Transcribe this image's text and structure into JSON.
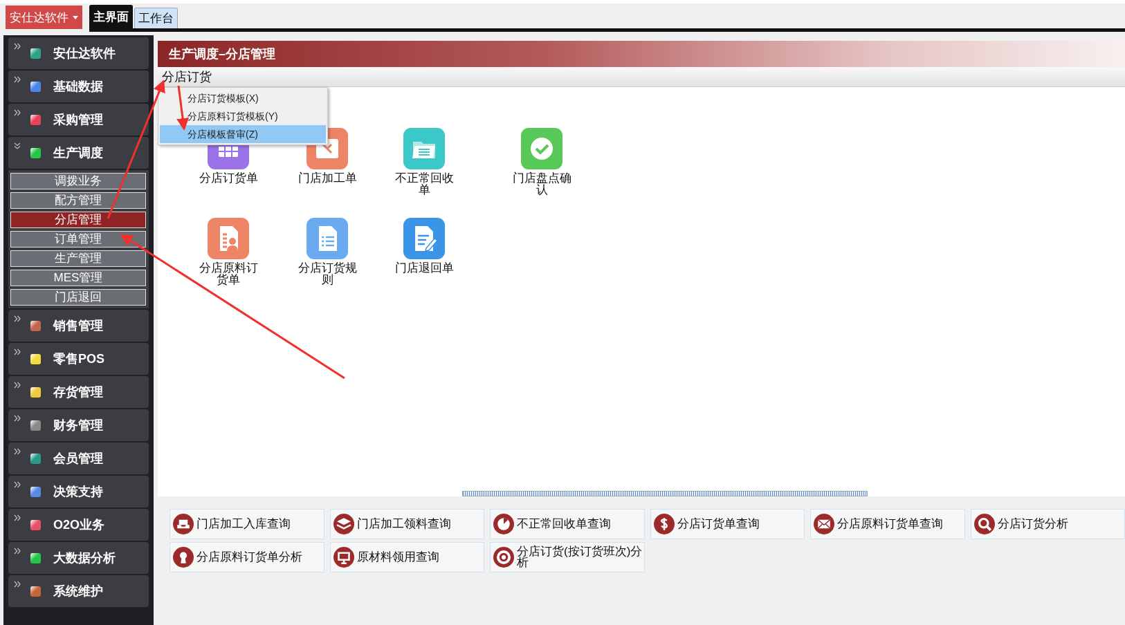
{
  "brand_menu": {
    "label": "安仕达软件"
  },
  "tabs": [
    {
      "label": "主界面",
      "selected": true
    },
    {
      "label": "工作台",
      "selected": false
    }
  ],
  "sidebar": {
    "items": [
      {
        "label": "安仕达软件",
        "color": "#2aa58a",
        "expanded": false
      },
      {
        "label": "基础数据",
        "color": "#4a86e8",
        "expanded": false
      },
      {
        "label": "采购管理",
        "color": "#e8415a",
        "expanded": false
      },
      {
        "label": "生产调度",
        "color": "#22c84a",
        "expanded": true,
        "children": [
          {
            "label": "调拨业务",
            "selected": false
          },
          {
            "label": "配方管理",
            "selected": false
          },
          {
            "label": "分店管理",
            "selected": true
          },
          {
            "label": "订单管理",
            "selected": false
          },
          {
            "label": "生产管理",
            "selected": false
          },
          {
            "label": "MES管理",
            "selected": false
          },
          {
            "label": "门店退回",
            "selected": false
          }
        ]
      },
      {
        "label": "销售管理",
        "color": "#c0664a",
        "expanded": false
      },
      {
        "label": "零售POS",
        "color": "#f2dc3c",
        "expanded": false
      },
      {
        "label": "存货管理",
        "color": "#f2c83c",
        "expanded": false
      },
      {
        "label": "财务管理",
        "color": "#8a8a8a",
        "expanded": false
      },
      {
        "label": "会员管理",
        "color": "#2a9a88",
        "expanded": false
      },
      {
        "label": "决策支持",
        "color": "#5a8ae8",
        "expanded": false
      },
      {
        "label": "O2O业务",
        "color": "#e8506a",
        "expanded": false
      },
      {
        "label": "大数据分析",
        "color": "#22c84a",
        "expanded": false
      },
      {
        "label": "系统维护",
        "color": "#c8643a",
        "expanded": false
      }
    ]
  },
  "page_title": "生产调度–分店管理",
  "toolbar_menu": {
    "label": "分店订货",
    "items": [
      {
        "label": "分店订货模板(X)",
        "selected": false
      },
      {
        "label": "分店原料订货模板(Y)",
        "selected": false
      },
      {
        "label": "分店模板督审(Z)",
        "selected": true
      }
    ]
  },
  "function_icons": [
    {
      "label": "分店订货单",
      "kind": "grid"
    },
    {
      "label": "门店加工单",
      "kind": "tool"
    },
    {
      "label": "不正常回收单",
      "kind": "folder"
    },
    {
      "label": "门店盘点确认",
      "kind": "check"
    },
    {
      "label": "分店原料订货单",
      "kind": "person-doc"
    },
    {
      "label": "分店订货规则",
      "kind": "list-doc"
    },
    {
      "label": "门店退回单",
      "kind": "edit-doc"
    }
  ],
  "quick_links": [
    {
      "label": "门店加工入库查询",
      "kind": "inbox"
    },
    {
      "label": "门店加工领料查询",
      "kind": "layers"
    },
    {
      "label": "不正常回收单查询",
      "kind": "pie"
    },
    {
      "label": "分店订货单查询",
      "kind": "dollar"
    },
    {
      "label": "分店原料订货单查询",
      "kind": "mail"
    },
    {
      "label": "分店订货分析",
      "kind": "search"
    },
    {
      "label": "分店原料订货单分析",
      "kind": "keyhole"
    },
    {
      "label": "原材料领用查询",
      "kind": "monitor"
    },
    {
      "label": "分店订货(按订货班次)分析",
      "kind": "lifebuoy"
    }
  ]
}
